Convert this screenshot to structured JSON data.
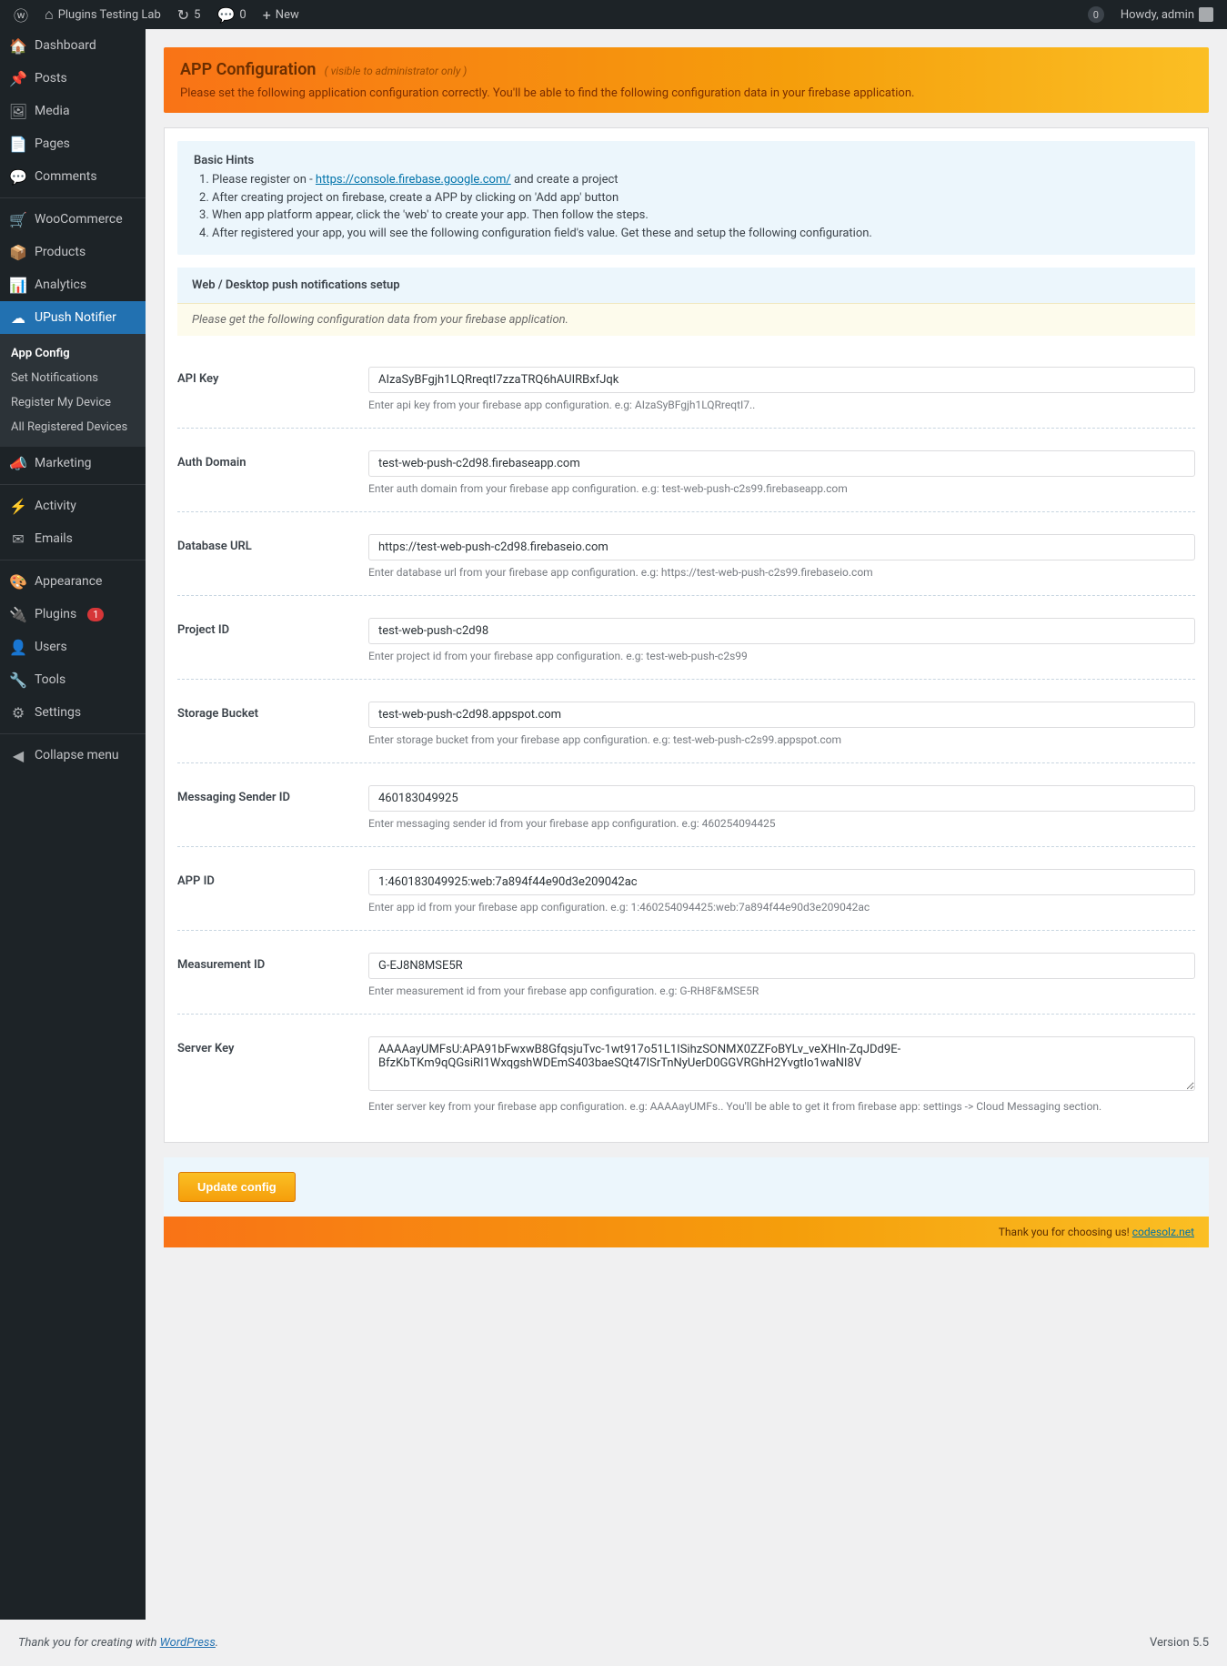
{
  "adminbar": {
    "site_name": "Plugins Testing Lab",
    "updates": "5",
    "comments": "0",
    "new": "New",
    "howdy": "Howdy, admin"
  },
  "sidebar": {
    "items": [
      {
        "icon": "🏠",
        "label": "Dashboard"
      },
      {
        "icon": "📌",
        "label": "Posts"
      },
      {
        "icon": "🖼",
        "label": "Media"
      },
      {
        "icon": "📄",
        "label": "Pages"
      },
      {
        "icon": "💬",
        "label": "Comments"
      },
      {
        "sep": true
      },
      {
        "icon": "🛒",
        "label": "WooCommerce"
      },
      {
        "icon": "📦",
        "label": "Products"
      },
      {
        "icon": "📊",
        "label": "Analytics"
      },
      {
        "icon": "☁",
        "label": "UPush Notifier",
        "current": true
      },
      {
        "icon": "📣",
        "label": "Marketing"
      },
      {
        "sep": true
      },
      {
        "icon": "⚡",
        "label": "Activity"
      },
      {
        "icon": "✉",
        "label": "Emails"
      },
      {
        "sep": true
      },
      {
        "icon": "🎨",
        "label": "Appearance"
      },
      {
        "icon": "🔌",
        "label": "Plugins",
        "badge": "1"
      },
      {
        "icon": "👤",
        "label": "Users"
      },
      {
        "icon": "🔧",
        "label": "Tools"
      },
      {
        "icon": "⚙",
        "label": "Settings"
      },
      {
        "sep": true
      },
      {
        "icon": "◀",
        "label": "Collapse menu"
      }
    ],
    "submenu": [
      {
        "label": "App Config",
        "current": true
      },
      {
        "label": "Set Notifications"
      },
      {
        "label": "Register My Device"
      },
      {
        "label": "All Registered Devices"
      }
    ]
  },
  "header": {
    "title": "APP Configuration",
    "subtitle": "( visible to administrator only )",
    "desc": "Please set the following application configuration correctly. You'll be able to find the following configuration data in your firebase application."
  },
  "hints": {
    "title": "Basic Hints",
    "prefix": "Please register on - ",
    "link": "https://console.firebase.google.com/",
    "suffix": " and create a project",
    "item2": "After creating project on firebase, create a APP by clicking on 'Add app' button",
    "item3": "When app platform appear, click the 'web' to create your app. Then follow the steps.",
    "item4": "After registered your app, you will see the following configuration field's value. Get these and setup the following configuration."
  },
  "section": {
    "title": "Web / Desktop push notifications setup",
    "note": "Please get the following configuration data from your firebase application."
  },
  "fields": [
    {
      "label": "API Key",
      "value": "AIzaSyBFgjh1LQRreqtI7zzaTRQ6hAUIRBxfJqk",
      "help": "Enter api key from your firebase app configuration. e.g: AIzaSyBFgjh1LQRreqtI7.."
    },
    {
      "label": "Auth Domain",
      "value": "test-web-push-c2d98.firebaseapp.com",
      "help": "Enter auth domain from your firebase app configuration. e.g: test-web-push-c2s99.firebaseapp.com"
    },
    {
      "label": "Database URL",
      "value": "https://test-web-push-c2d98.firebaseio.com",
      "help": "Enter database url from your firebase app configuration. e.g: https://test-web-push-c2s99.firebaseio.com"
    },
    {
      "label": "Project ID",
      "value": "test-web-push-c2d98",
      "help": "Enter project id from your firebase app configuration. e.g: test-web-push-c2s99"
    },
    {
      "label": "Storage Bucket",
      "value": "test-web-push-c2d98.appspot.com",
      "help": "Enter storage bucket from your firebase app configuration. e.g: test-web-push-c2s99.appspot.com"
    },
    {
      "label": "Messaging Sender ID",
      "value": "460183049925",
      "help": "Enter messaging sender id from your firebase app configuration. e.g: 460254094425"
    },
    {
      "label": "APP ID",
      "value": "1:460183049925:web:7a894f44e90d3e209042ac",
      "help": "Enter app id from your firebase app configuration. e.g: 1:460254094425:web:7a894f44e90d3e209042ac"
    },
    {
      "label": "Measurement ID",
      "value": "G-EJ8N8MSE5R",
      "help": "Enter measurement id from your firebase app configuration. e.g: G-RH8F&MSE5R"
    },
    {
      "label": "Server Key",
      "value": "AAAAayUMFsU:APA91bFwxwB8GfqsjuTvc-1wt917o51L1ISihzSONMX0ZZFoBYLv_veXHIn-ZqJDd9E-BfzKbTKm9qQGsiRI1WxqgshWDEmS403baeSQt47ISrTnNyUerD0GGVRGhH2YvgtIo1waNI8V",
      "help": "Enter server key from your firebase app configuration. e.g: AAAAayUMFs.. You'll be able to get it from firebase app: settings -> Cloud Messaging section.",
      "textarea": true
    }
  ],
  "submit": {
    "label": "Update config"
  },
  "footer_bar": {
    "text": "Thank you for choosing us! ",
    "link": "codesolz.net"
  },
  "wp_footer": {
    "left_prefix": "Thank you for creating with ",
    "left_link": "WordPress",
    "right": "Version 5.5"
  }
}
